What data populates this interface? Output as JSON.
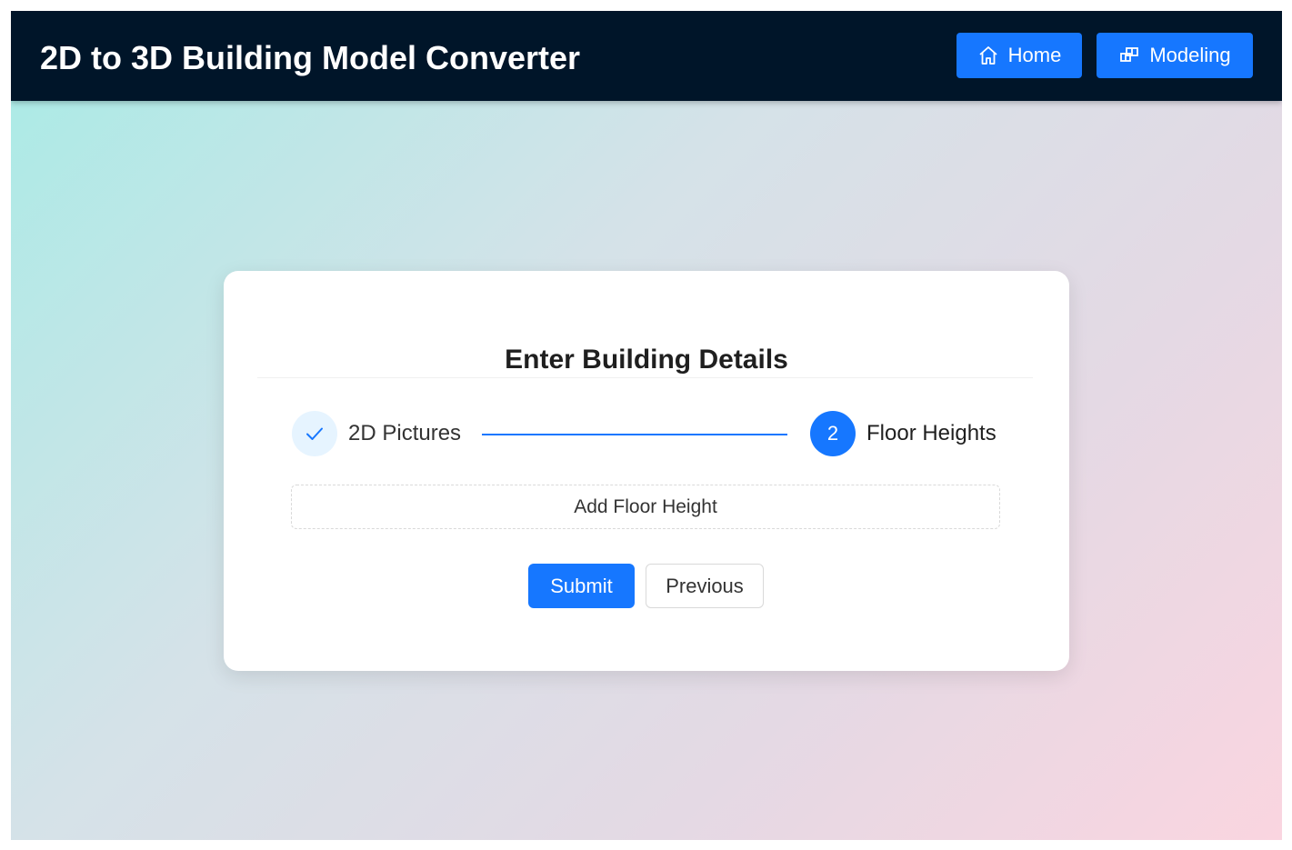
{
  "header": {
    "title": "2D to 3D Building Model Converter",
    "nav": {
      "home": {
        "label": "Home",
        "icon": "home-icon"
      },
      "modeling": {
        "label": "Modeling",
        "icon": "blocks-icon"
      }
    }
  },
  "card": {
    "title": "Enter Building Details",
    "steps": [
      {
        "label": "2D Pictures",
        "status": "finished",
        "icon": "check-icon"
      },
      {
        "label": "Floor Heights",
        "status": "current",
        "number": "2"
      }
    ],
    "add_floor_label": "Add Floor Height",
    "submit_label": "Submit",
    "previous_label": "Previous"
  },
  "colors": {
    "header_bg": "#001529",
    "accent": "#1677ff",
    "step_done_bg": "#e6f4ff"
  }
}
